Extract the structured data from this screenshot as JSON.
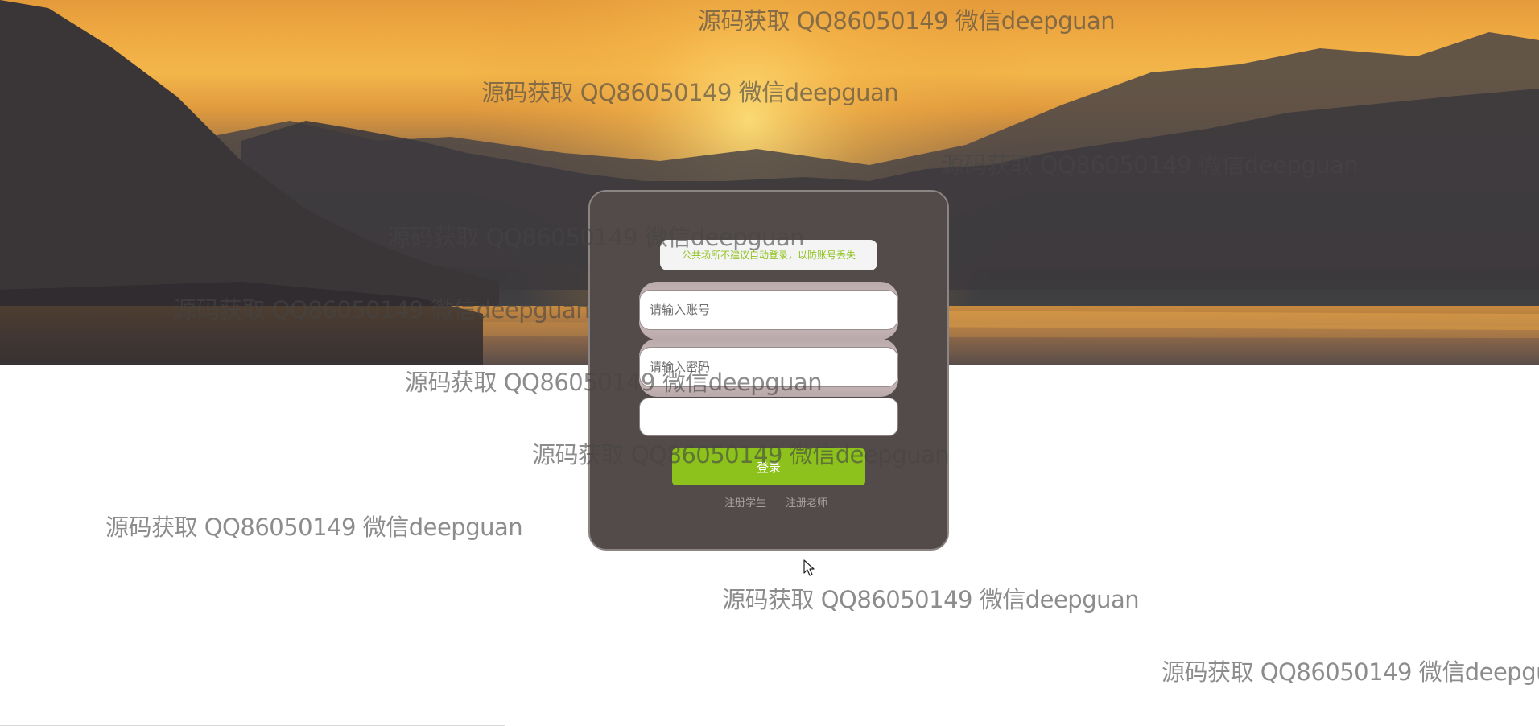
{
  "login": {
    "notice": "公共场所不建议自动登录，以防账号丢失",
    "username_placeholder": "请输入账号",
    "password_placeholder": "请输入密码",
    "captcha_value": "",
    "submit_label": "登录",
    "register_student_label": "注册学生",
    "register_teacher_label": "注册老师"
  },
  "watermark": {
    "text": "源码获取 QQ86050149 微信deepguan",
    "count": 10
  },
  "colors": {
    "panel": "#524b49",
    "accent_green": "#8dc21c",
    "notice_text": "#8ec21c",
    "link": "#a7a09e"
  },
  "icons": {
    "pointer": "mouse-pointer-icon"
  }
}
